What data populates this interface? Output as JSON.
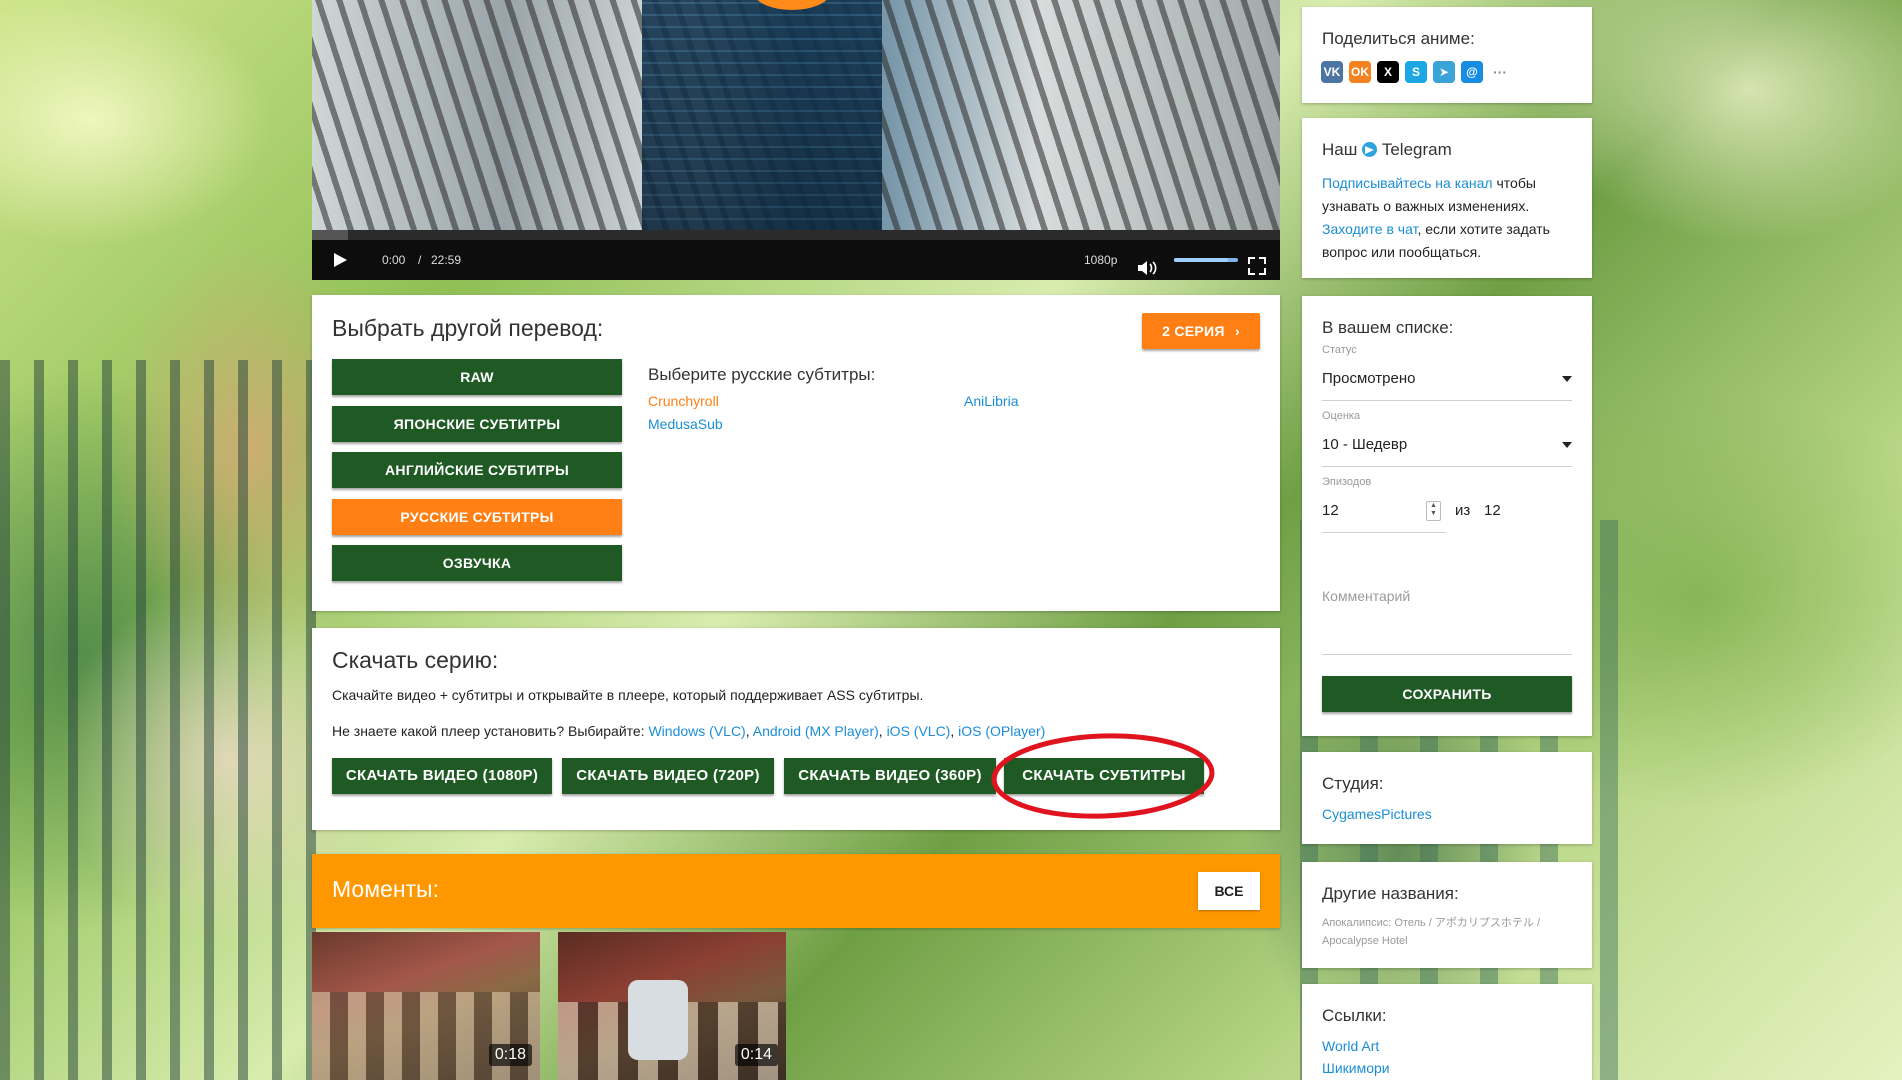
{
  "player": {
    "time_current": "0:00",
    "time_separator": "/",
    "time_total": "22:59",
    "quality": "1080p",
    "volume_fraction": 0.85,
    "progress_fraction": 0.0,
    "icons": {
      "play": "play-icon",
      "volume": "volume-icon",
      "fullscreen": "fullscreen-icon"
    }
  },
  "translation": {
    "title": "Выбрать другой перевод:",
    "next_episode": "2 СЕРИЯ",
    "types": [
      {
        "label": "RAW",
        "active": false
      },
      {
        "label": "ЯПОНСКИЕ СУБТИТРЫ",
        "active": false
      },
      {
        "label": "АНГЛИЙСКИЕ СУБТИТРЫ",
        "active": false
      },
      {
        "label": "РУССКИЕ СУБТИТРЫ",
        "active": true
      },
      {
        "label": "ОЗВУЧКА",
        "active": false
      }
    ],
    "subs_title": "Выберите русские субтитры:",
    "subs": [
      {
        "label": "Crunchyroll",
        "active": true
      },
      {
        "label": "AniLibria",
        "active": false
      },
      {
        "label": "MedusaSub",
        "active": false
      }
    ]
  },
  "download": {
    "title": "Скачать серию:",
    "desc": "Скачайте видео + субтитры и открывайте в плеере, который поддерживает ASS субтитры.",
    "player_q": "Не знаете какой плеер установить? Выбирайте:",
    "players": [
      "Windows (VLC)",
      "Android (MX Player)",
      "iOS (VLC)",
      "iOS (OPlayer)"
    ],
    "sep": ",",
    "buttons": [
      "СКАЧАТЬ ВИДЕО (1080P)",
      "СКАЧАТЬ ВИДЕО (720P)",
      "СКАЧАТЬ ВИДЕО (360P)",
      "СКАЧАТЬ СУБТИТРЫ"
    ]
  },
  "moments": {
    "title": "Моменты:",
    "all_button": "ВСЕ",
    "items": [
      {
        "duration": "0:18"
      },
      {
        "duration": "0:14"
      }
    ]
  },
  "sidebar": {
    "share": {
      "title": "Поделиться аниме:",
      "icons": [
        {
          "name": "vk-icon",
          "glyph": "VK",
          "color": "#4c75a3"
        },
        {
          "name": "odnoklassniki-icon",
          "glyph": "OK",
          "color": "#f58220"
        },
        {
          "name": "x-icon",
          "glyph": "X",
          "color": "#000000"
        },
        {
          "name": "skype-icon",
          "glyph": "S",
          "color": "#1ca6e3"
        },
        {
          "name": "telegram-icon",
          "glyph": "➤",
          "color": "#3aa3d8"
        },
        {
          "name": "moimir-icon",
          "glyph": "@",
          "color": "#168de2"
        },
        {
          "name": "more-icon",
          "glyph": "···",
          "color": "#ffffff"
        }
      ]
    },
    "telegram": {
      "title_prefix": "Наш",
      "title_suffix": "Telegram",
      "subscribe_link": "Подписывайтесь на канал",
      "subscribe_rest": " чтобы узнавать о важных изменениях.",
      "chat_link": "Заходите в чат",
      "chat_rest": ", если хотите задать вопрос или пообщаться."
    },
    "list": {
      "title": "В вашем списке:",
      "status_label": "Статус",
      "status_value": "Просмотрено",
      "rating_label": "Оценка",
      "rating_value": "10 - Шедевр",
      "episodes_label": "Эпизодов",
      "episodes_value": "12",
      "episodes_of": "из",
      "episodes_total": "12",
      "comment_placeholder": "Комментарий",
      "save": "СОХРАНИТЬ"
    },
    "studio": {
      "title": "Студия:",
      "value": "CygamesPictures"
    },
    "other_names": {
      "title": "Другие названия:",
      "value": "Апокалипсис: Отель / アポカリプスホテル / Apocalypse Hotel"
    },
    "links": {
      "title": "Ссылки:",
      "items": [
        "World Art",
        "Шикимори"
      ]
    }
  },
  "annotation": {
    "color": "#e0141e"
  }
}
